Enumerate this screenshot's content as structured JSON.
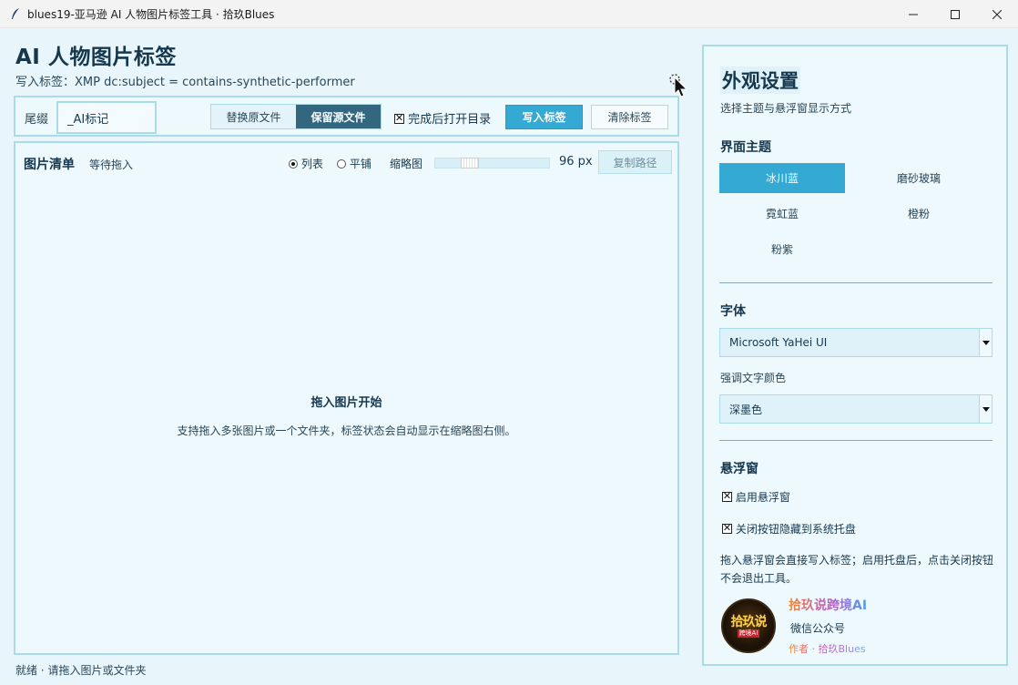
{
  "window": {
    "title": "blues19-亚马逊 AI 人物图片标签工具 · 拾玖Blues"
  },
  "header": {
    "title": "AI 人物图片标签",
    "subtitle": "写入标签：XMP dc:subject = contains-synthetic-performer"
  },
  "toolbar": {
    "suffix_label": "尾缀",
    "suffix_value": "_AI标记",
    "mode_replace": "替换原文件",
    "mode_keep": "保留源文件",
    "open_dir_label": "完成后打开目录",
    "open_dir_checked": true,
    "write_button": "写入标签",
    "clear_button": "清除标签"
  },
  "list": {
    "title": "图片清单",
    "status": "等待拖入",
    "view_list": "列表",
    "view_tile": "平铺",
    "view_selected": "列表",
    "thumb_label": "缩略图",
    "thumb_size": "96 px",
    "copy_button": "复制路径",
    "drop_title": "拖入图片开始",
    "drop_hint": "支持拖入多张图片或一个文件夹，标签状态会自动显示在缩略图右侧。"
  },
  "statusbar": {
    "text": "就绪 · 请拖入图片或文件夹"
  },
  "settings": {
    "title": "外观设置",
    "subtitle": "选择主题与悬浮窗显示方式",
    "theme_section": "界面主题",
    "themes": [
      "冰川蓝",
      "磨砂玻璃",
      "霓虹蓝",
      "橙粉",
      "粉紫"
    ],
    "active_theme": "冰川蓝",
    "font_section": "字体",
    "font_value": "Microsoft YaHei UI",
    "accent_label": "强调文字颜色",
    "accent_value": "深墨色",
    "float_section": "悬浮窗",
    "float_enable": "启用悬浮窗",
    "float_tray": "关闭按钮隐藏到系统托盘",
    "float_desc": "拖入悬浮窗会直接写入标签；启用托盘后，点击关闭按钮不会退出工具。",
    "avatar_text": "拾玖说",
    "avatar_badge": "跨境AI",
    "brand": "拾玖说跨境AI",
    "wechat": "微信公众号",
    "author": "作者 · 拾玖Blues"
  },
  "colors": {
    "accent": "#34a9d3",
    "dark": "#33667f",
    "border": "#a9dbe9",
    "text": "#16384f"
  }
}
